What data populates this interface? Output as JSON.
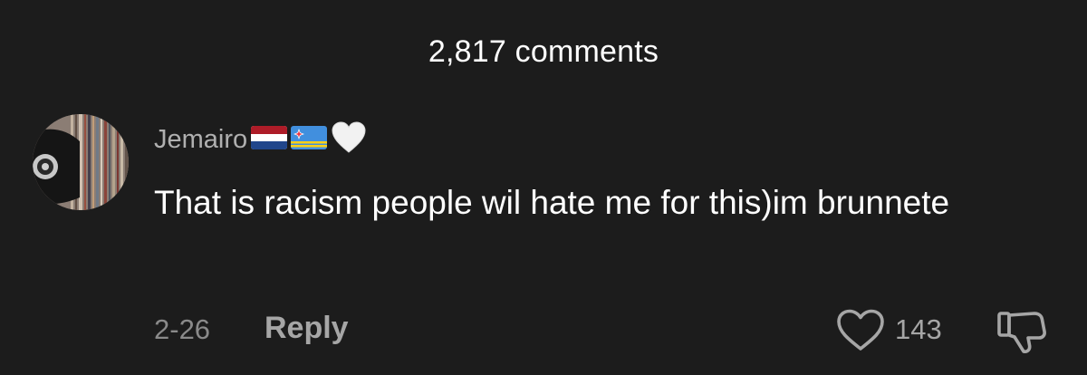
{
  "header": {
    "title": "2,817 comments"
  },
  "comment": {
    "username": "Jemairo",
    "username_decorations": [
      "netherlands-flag",
      "aruba-flag",
      "white-heart"
    ],
    "text": "That is racism people wil hate me for this)im brunnete",
    "date": "2-26",
    "reply_label": "Reply",
    "like_count": "143",
    "liked": false,
    "disliked": false
  },
  "colors": {
    "background": "#1c1c1c",
    "primary_text": "#ffffff",
    "secondary_text": "#b0b0b0",
    "muted_text": "#8a8a8a"
  }
}
